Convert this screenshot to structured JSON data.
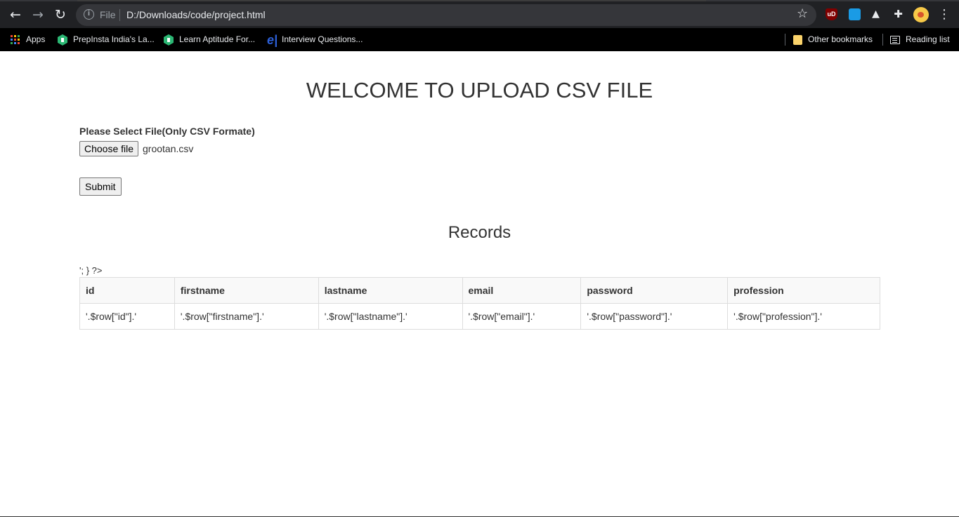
{
  "browser": {
    "nav": {
      "back_icon": "←",
      "forward_icon": "→",
      "reload_icon": "↻"
    },
    "omnibox": {
      "scheme_label": "File",
      "url": "D:/Downloads/code/project.html",
      "info_icon": "i"
    },
    "star_icon": "☆",
    "extensions": {
      "ublock_text": "uD",
      "mountain_icon": "▲",
      "puzzle_icon": "✚"
    },
    "menu_icon": "⋮",
    "bookmarks": {
      "apps": "Apps",
      "items": [
        "PrepInsta India's La...",
        "Learn Aptitude For...",
        "Interview Questions..."
      ],
      "e_logo": "e|",
      "other": "Other bookmarks",
      "reading_list": "Reading list"
    }
  },
  "page": {
    "title": "WELCOME TO UPLOAD CSV FILE",
    "upload": {
      "label": "Please Select File(Only CSV Formate)",
      "choose_label": "Choose file",
      "file_name": "grootan.csv",
      "submit_label": "Submit"
    },
    "records": {
      "title": "Records",
      "leak_text": "'; } ?>",
      "columns": [
        "id",
        "firstname",
        "lastname",
        "email",
        "password",
        "profession"
      ],
      "rows": [
        [
          "'.$row[\"id\"].'",
          "'.$row[\"firstname\"].'",
          "'.$row[\"lastname\"].'",
          "'.$row[\"email\"].'",
          "'.$row[\"password\"].'",
          "'.$row[\"profession\"].'"
        ]
      ]
    }
  },
  "colors": {
    "chrome_toolbar": "#202124",
    "omnibox_bg": "#35363a",
    "bookmarks_bar": "#000000",
    "table_border": "#dddddd",
    "header_bg": "#f9f9f9"
  }
}
